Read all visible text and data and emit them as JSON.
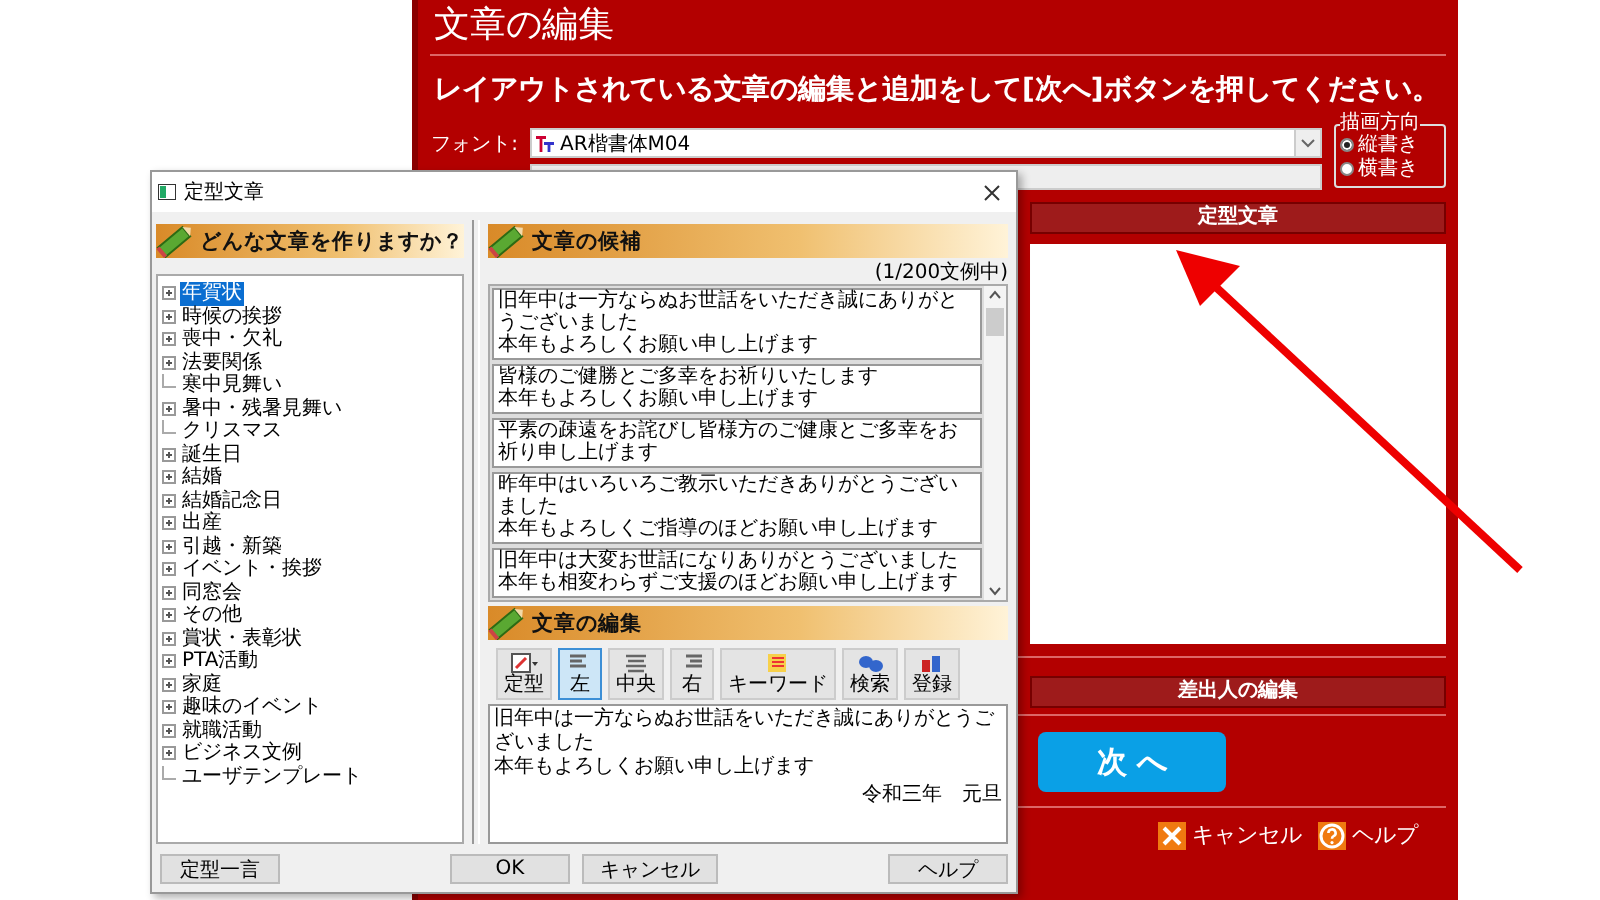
{
  "main": {
    "title": "文章の編集",
    "instruction": "レイアウトされている文章の編集と追加をして[次へ]ボタンを押してください。",
    "font_label": "フォント:",
    "font_value": "AR楷書体M04",
    "orientation": {
      "legend": "描画方向",
      "options": [
        {
          "label": "縦書き",
          "selected": true
        },
        {
          "label": "横書き",
          "selected": false
        }
      ]
    },
    "template_bar": "定型文章",
    "sender_bar": "差出人の編集",
    "next_button": "次 へ",
    "footer": [
      {
        "kind": "cancel",
        "label": "キャンセル"
      },
      {
        "kind": "help",
        "label": "ヘルプ"
      }
    ]
  },
  "dialog": {
    "title": "定型文章",
    "left_header": "どんな文章を作りますか？",
    "tree": [
      {
        "label": "年賀状",
        "expandable": true,
        "selected": true
      },
      {
        "label": "時候の挨拶",
        "expandable": true,
        "selected": false
      },
      {
        "label": "喪中・欠礼",
        "expandable": true,
        "selected": false
      },
      {
        "label": "法要関係",
        "expandable": true,
        "selected": false
      },
      {
        "label": "寒中見舞い",
        "expandable": false,
        "selected": false
      },
      {
        "label": "暑中・残暑見舞い",
        "expandable": true,
        "selected": false
      },
      {
        "label": "クリスマス",
        "expandable": false,
        "selected": false
      },
      {
        "label": "誕生日",
        "expandable": true,
        "selected": false
      },
      {
        "label": "結婚",
        "expandable": true,
        "selected": false
      },
      {
        "label": "結婚記念日",
        "expandable": true,
        "selected": false
      },
      {
        "label": "出産",
        "expandable": true,
        "selected": false
      },
      {
        "label": "引越・新築",
        "expandable": true,
        "selected": false
      },
      {
        "label": "イベント・挨拶",
        "expandable": true,
        "selected": false
      },
      {
        "label": "同窓会",
        "expandable": true,
        "selected": false
      },
      {
        "label": "その他",
        "expandable": true,
        "selected": false
      },
      {
        "label": "賞状・表彰状",
        "expandable": true,
        "selected": false
      },
      {
        "label": "PTA活動",
        "expandable": true,
        "selected": false
      },
      {
        "label": "家庭",
        "expandable": true,
        "selected": false
      },
      {
        "label": "趣味のイベント",
        "expandable": true,
        "selected": false
      },
      {
        "label": "就職活動",
        "expandable": true,
        "selected": false
      },
      {
        "label": "ビジネス文例",
        "expandable": true,
        "selected": false
      },
      {
        "label": "ユーザテンプレート",
        "expandable": false,
        "selected": false
      }
    ],
    "candidates_header": "文章の候補",
    "candidates_count": "(1/200文例中)",
    "candidates": [
      {
        "lines": [
          "旧年中は一方ならぬお世話をいただき誠にありがとうございました",
          "本年もよろしくお願い申し上げます"
        ]
      },
      {
        "lines": [
          "皆様のご健勝とご多幸をお祈りいたします",
          "本年もよろしくお願い申し上げます"
        ]
      },
      {
        "lines": [
          "平素の疎遠をお詫びし皆様方のご健康とご多幸をお祈り申し上げます"
        ]
      },
      {
        "lines": [
          "昨年中はいろいろご教示いただきありがとうございました",
          "本年もよろしくご指導のほどお願い申し上げます"
        ]
      },
      {
        "lines": [
          "旧年中は大変お世話になりありがとうございました",
          "本年も相変わらずご支援のほどお願い申し上げます"
        ]
      }
    ],
    "editor_header": "文章の編集",
    "toolbar": [
      {
        "kind": "template",
        "label": "定型",
        "selected": false
      },
      {
        "kind": "left",
        "label": "左",
        "selected": true
      },
      {
        "kind": "center",
        "label": "中央",
        "selected": false
      },
      {
        "kind": "right",
        "label": "右",
        "selected": false
      },
      {
        "kind": "keyword",
        "label": "キーワード",
        "selected": false
      },
      {
        "kind": "search",
        "label": "検索",
        "selected": false
      },
      {
        "kind": "register",
        "label": "登録",
        "selected": false
      }
    ],
    "editor_lines": [
      "旧年中は一方ならぬお世話をいただき誠にありがとうございました",
      "本年もよろしくお願い申し上げます"
    ],
    "editor_date": "令和三年　元旦",
    "buttons": [
      {
        "kind": "left",
        "label": "定型一言"
      },
      {
        "kind": "right",
        "label": "OK"
      },
      {
        "kind": "right",
        "label": "キャンセル"
      },
      {
        "kind": "help",
        "label": "ヘルプ"
      }
    ]
  }
}
